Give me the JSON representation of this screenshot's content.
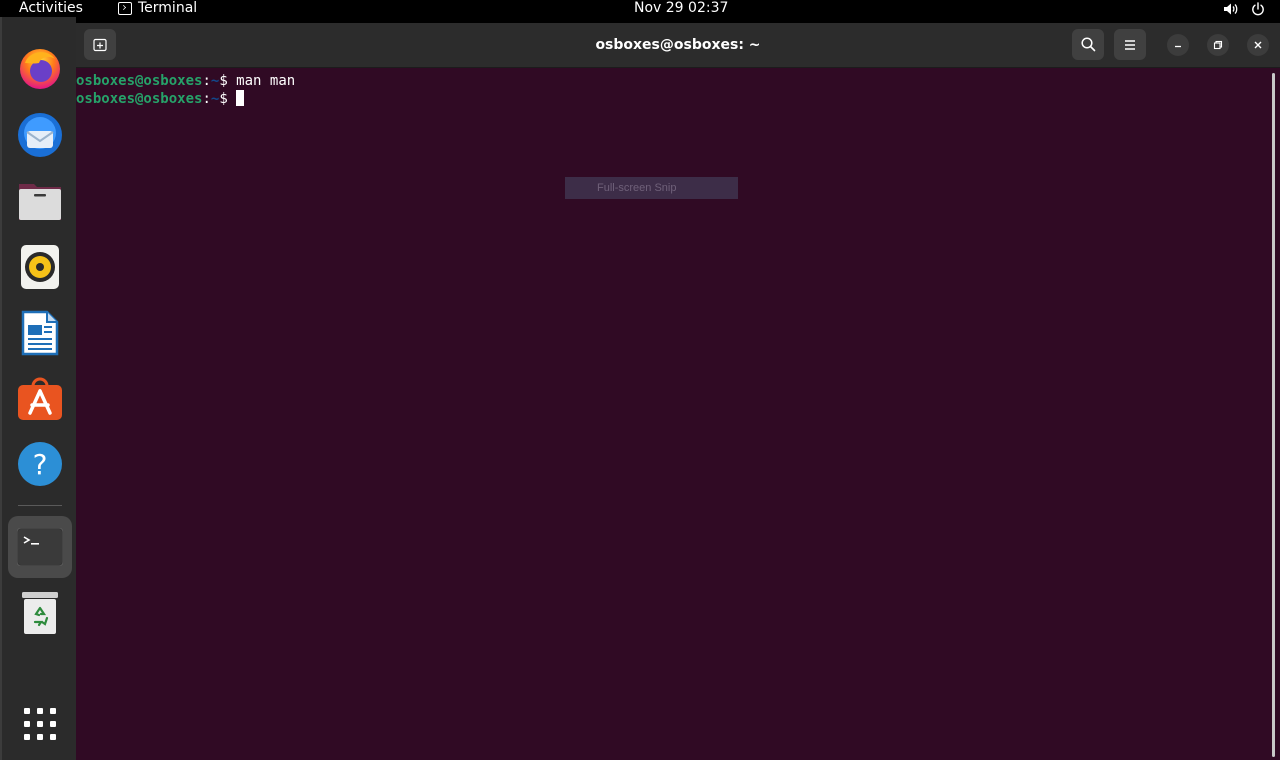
{
  "topbar": {
    "activities": "Activities",
    "app_name": "Terminal",
    "clock": "Nov 29  02:37",
    "icons": [
      "terminal-icon",
      "volume-icon",
      "power-icon"
    ]
  },
  "dock": {
    "items": [
      {
        "name": "firefox",
        "icon": "firefox-icon"
      },
      {
        "name": "thunderbird",
        "icon": "thunderbird-icon"
      },
      {
        "name": "files",
        "icon": "files-icon"
      },
      {
        "name": "rhythmbox",
        "icon": "rhythmbox-icon"
      },
      {
        "name": "libreoffice-writer",
        "icon": "writer-icon"
      },
      {
        "name": "ubuntu-software",
        "icon": "software-icon"
      },
      {
        "name": "help",
        "icon": "help-icon"
      },
      {
        "name": "terminal",
        "icon": "terminal-icon",
        "active": true,
        "running": true
      },
      {
        "name": "trash",
        "icon": "trash-icon"
      },
      {
        "name": "show-applications",
        "icon": "app-grid-icon"
      }
    ]
  },
  "window": {
    "title": "osboxes@osboxes: ~",
    "icons": [
      "new-tab-icon",
      "search-icon",
      "hamburger-menu-icon",
      "minimize-icon",
      "maximize-icon",
      "close-icon"
    ]
  },
  "terminal": {
    "lines": [
      {
        "user": "osboxes@osboxes",
        "sep": ":",
        "path": "~",
        "prompt": "$ ",
        "command": "man man"
      },
      {
        "user": "osboxes@osboxes",
        "sep": ":",
        "path": "~",
        "prompt": "$ ",
        "command": ""
      }
    ]
  },
  "overlay": {
    "snip_label": "Full-screen Snip"
  },
  "colors": {
    "terminal_bg": "#300a24",
    "prompt_user": "#26a269",
    "prompt_path": "#12488b",
    "accent": "#e95420"
  }
}
